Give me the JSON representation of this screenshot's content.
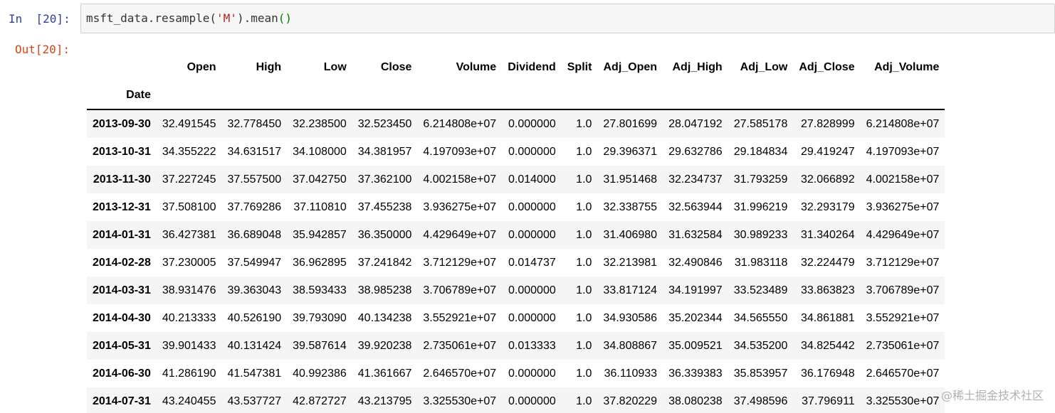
{
  "cell": {
    "in_prompt": "In  [20]:",
    "out_prompt": "Out[20]:",
    "code": {
      "prefix": "msft_data.resample(",
      "string_arg": "'M'",
      "middle": ").mean",
      "parens": "()"
    }
  },
  "table": {
    "columns": [
      "Open",
      "High",
      "Low",
      "Close",
      "Volume",
      "Dividend",
      "Split",
      "Adj_Open",
      "Adj_High",
      "Adj_Low",
      "Adj_Close",
      "Adj_Volume"
    ],
    "index_name": "Date",
    "rows": [
      {
        "date": "2013-09-30",
        "values": [
          "32.491545",
          "32.778450",
          "32.238500",
          "32.523450",
          "6.214808e+07",
          "0.000000",
          "1.0",
          "27.801699",
          "28.047192",
          "27.585178",
          "27.828999",
          "6.214808e+07"
        ]
      },
      {
        "date": "2013-10-31",
        "values": [
          "34.355222",
          "34.631517",
          "34.108000",
          "34.381957",
          "4.197093e+07",
          "0.000000",
          "1.0",
          "29.396371",
          "29.632786",
          "29.184834",
          "29.419247",
          "4.197093e+07"
        ]
      },
      {
        "date": "2013-11-30",
        "values": [
          "37.227245",
          "37.557500",
          "37.042750",
          "37.362100",
          "4.002158e+07",
          "0.014000",
          "1.0",
          "31.951468",
          "32.234737",
          "31.793259",
          "32.066892",
          "4.002158e+07"
        ]
      },
      {
        "date": "2013-12-31",
        "values": [
          "37.508100",
          "37.769286",
          "37.110810",
          "37.455238",
          "3.936275e+07",
          "0.000000",
          "1.0",
          "32.338755",
          "32.563944",
          "31.996219",
          "32.293179",
          "3.936275e+07"
        ]
      },
      {
        "date": "2014-01-31",
        "values": [
          "36.427381",
          "36.689048",
          "35.942857",
          "36.350000",
          "4.429649e+07",
          "0.000000",
          "1.0",
          "31.406980",
          "31.632584",
          "30.989233",
          "31.340264",
          "4.429649e+07"
        ]
      },
      {
        "date": "2014-02-28",
        "values": [
          "37.230005",
          "37.549947",
          "36.962895",
          "37.241842",
          "3.712129e+07",
          "0.014737",
          "1.0",
          "32.213981",
          "32.490846",
          "31.983118",
          "32.224479",
          "3.712129e+07"
        ]
      },
      {
        "date": "2014-03-31",
        "values": [
          "38.931476",
          "39.363043",
          "38.593433",
          "38.985238",
          "3.706789e+07",
          "0.000000",
          "1.0",
          "33.817124",
          "34.191997",
          "33.523489",
          "33.863823",
          "3.706789e+07"
        ]
      },
      {
        "date": "2014-04-30",
        "values": [
          "40.213333",
          "40.526190",
          "39.793090",
          "40.134238",
          "3.552921e+07",
          "0.000000",
          "1.0",
          "34.930586",
          "35.202344",
          "34.565550",
          "34.861881",
          "3.552921e+07"
        ]
      },
      {
        "date": "2014-05-31",
        "values": [
          "39.901433",
          "40.131424",
          "39.587614",
          "39.920238",
          "2.735061e+07",
          "0.013333",
          "1.0",
          "34.808867",
          "35.009521",
          "34.535200",
          "34.825442",
          "2.735061e+07"
        ]
      },
      {
        "date": "2014-06-30",
        "values": [
          "41.286190",
          "41.547381",
          "40.992386",
          "41.361667",
          "2.646570e+07",
          "0.000000",
          "1.0",
          "36.110933",
          "36.339383",
          "35.853957",
          "36.176948",
          "2.646570e+07"
        ]
      },
      {
        "date": "2014-07-31",
        "values": [
          "43.240455",
          "43.537727",
          "42.872727",
          "43.213795",
          "3.325530e+07",
          "0.000000",
          "1.0",
          "37.820229",
          "38.080238",
          "37.498596",
          "37.796911",
          "3.325530e+07"
        ]
      }
    ]
  },
  "watermark": "@稀土掘金技术社区",
  "colors": {
    "in_prompt": "#303f9f",
    "out_prompt": "#d84315",
    "code_string": "#ba2121",
    "code_parens": "#008000",
    "input_bg": "#f7f7f7",
    "row_stripe": "#f5f5f5"
  }
}
